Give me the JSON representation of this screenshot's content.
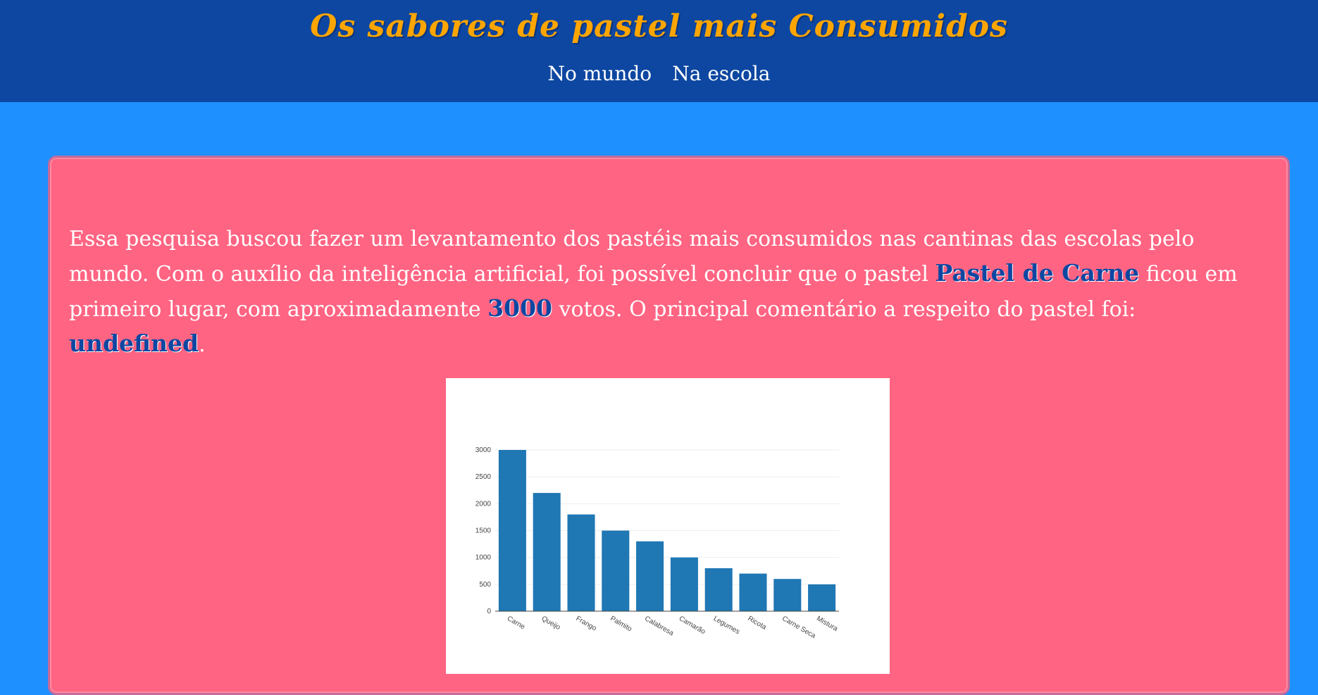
{
  "header": {
    "title": "Os sabores de pastel mais Consumidos",
    "nav": [
      {
        "label": "No mundo"
      },
      {
        "label": "Na escola"
      }
    ]
  },
  "summary": {
    "part1": "Essa pesquisa buscou fazer um levantamento dos pastéis mais consumidos nas cantinas das escolas pelo mundo. Com o auxílio da inteligência artificial, foi possível concluir que o pastel ",
    "top_flavor": "Pastel de Carne",
    "part2": " ficou em primeiro lugar, com aproximadamente ",
    "votes": "3000",
    "part3": " votos. O principal comentário a respeito do pastel foi: ",
    "comment": "undefined",
    "part4": "."
  },
  "colors": {
    "header_bg": "#0d47a1",
    "page_bg": "#1e90ff",
    "panel_bg": "#ff6482",
    "title_color": "#ffa500",
    "bar_color": "#1f77b4"
  },
  "chart_data": {
    "type": "bar",
    "categories": [
      "Carne",
      "Queijo",
      "Frango",
      "Palmito",
      "Calabresa",
      "Camarão",
      "Legumes",
      "Ricota",
      "Carne Seca",
      "Mistura"
    ],
    "values": [
      3000,
      2200,
      1800,
      1500,
      1300,
      1000,
      800,
      700,
      600,
      500
    ],
    "yticks": [
      0,
      500,
      1000,
      1500,
      2000,
      2500,
      3000
    ],
    "ylim": [
      0,
      3000
    ],
    "grid": true
  }
}
